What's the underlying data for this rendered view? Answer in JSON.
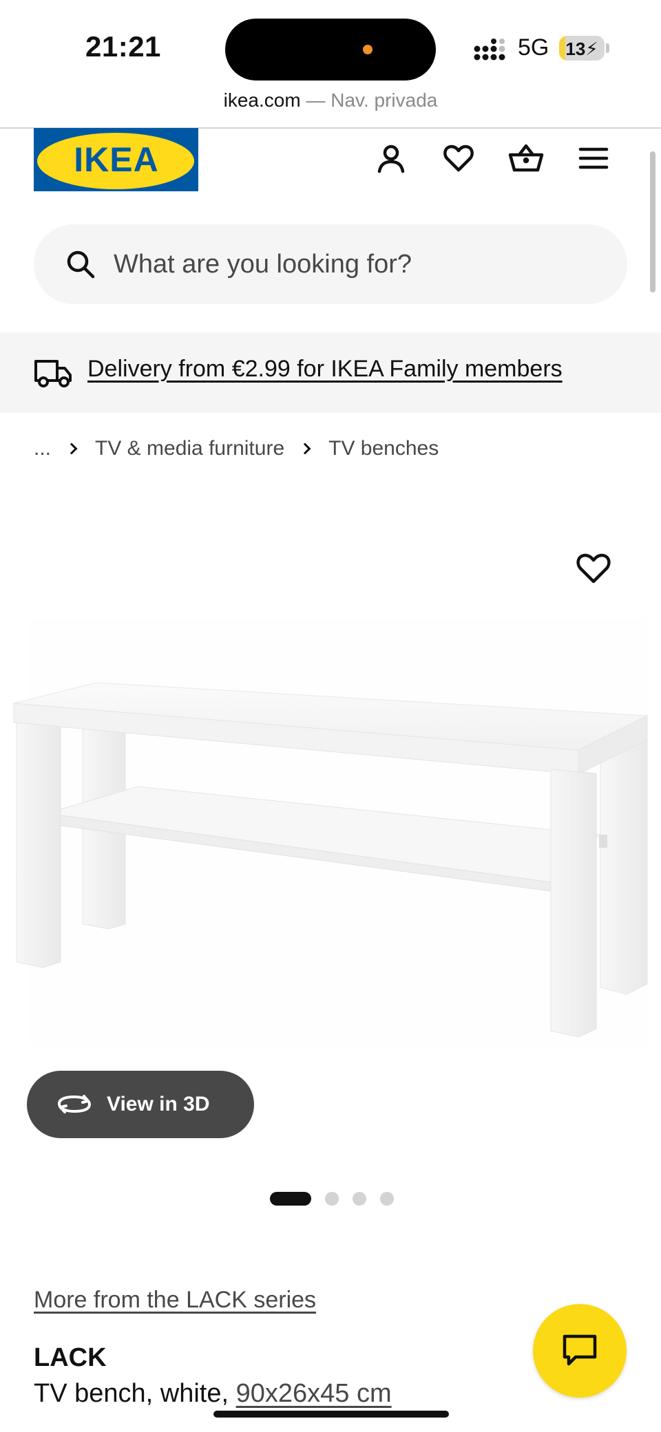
{
  "status_bar": {
    "time": "21:21",
    "network": "5G",
    "battery": "13",
    "battery_level": 0.13,
    "island_dot_color": "#f0902a"
  },
  "browser": {
    "domain": "ikea.com",
    "mode": "— Nav. privada"
  },
  "header": {
    "logo_text": "IKEA",
    "logo_colors": {
      "blue": "#0058a3",
      "yellow": "#ffda1a"
    },
    "icons": [
      "profile-icon",
      "heart-icon",
      "basket-icon",
      "menu-icon"
    ]
  },
  "search": {
    "placeholder": "What are you looking for?",
    "value": ""
  },
  "delivery_banner": {
    "text": "Delivery from €2.99 for IKEA Family members",
    "icon": "truck-icon"
  },
  "breadcrumb": {
    "ellipsis": "...",
    "items": [
      "TV & media furniture",
      "TV benches"
    ]
  },
  "gallery": {
    "view_3d_label": "View in 3D",
    "total_images": 4,
    "active_image": 1
  },
  "product": {
    "series_link": "More from the LACK series",
    "name": "LACK",
    "description": "TV bench, white, ",
    "dimensions": "90x26x45 cm"
  },
  "chat": {
    "icon": "chat-icon",
    "color": "#fbd914"
  }
}
